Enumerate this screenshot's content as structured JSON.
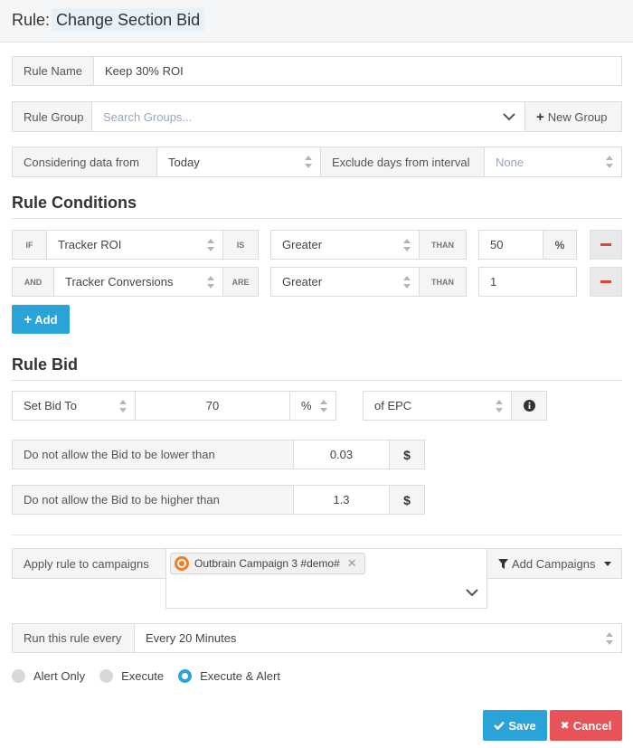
{
  "header": {
    "label": "Rule:",
    "title": "Change Section Bid"
  },
  "rule_name": {
    "label": "Rule Name",
    "value": "Keep 30% ROI"
  },
  "rule_group": {
    "label": "Rule Group",
    "placeholder": "Search Groups...",
    "new_group_label": "New Group"
  },
  "interval": {
    "label": "Considering data from",
    "value": "Today",
    "exclude_label": "Exclude days from interval",
    "exclude_value": "None"
  },
  "conditions": {
    "title": "Rule Conditions",
    "rows": [
      {
        "connector": "IF",
        "metric": "Tracker ROI",
        "verb": "IS",
        "operator": "Greater",
        "than": "THAN",
        "value": "50",
        "unit": "%"
      },
      {
        "connector": "AND",
        "metric": "Tracker Conversions",
        "verb": "ARE",
        "operator": "Greater",
        "than": "THAN",
        "value": "1",
        "unit": ""
      }
    ],
    "add_label": "Add"
  },
  "bid": {
    "title": "Rule Bid",
    "action": "Set Bid To",
    "amount": "70",
    "unit": "%",
    "reference": "of EPC",
    "min_label": "Do not allow the Bid to be lower than",
    "min_value": "0.03",
    "min_unit": "$",
    "max_label": "Do not allow the Bid to be higher than",
    "max_value": "1.3",
    "max_unit": "$"
  },
  "campaigns": {
    "label": "Apply rule to campaigns",
    "selected": [
      "Outbrain Campaign 3 #demo#"
    ],
    "add_label": "Add Campaigns"
  },
  "schedule": {
    "label": "Run this rule every",
    "value": "Every 20 Minutes"
  },
  "mode": {
    "options": [
      "Alert Only",
      "Execute",
      "Execute & Alert"
    ],
    "selected": "Execute & Alert"
  },
  "footer": {
    "save_label": "Save",
    "cancel_label": "Cancel"
  },
  "colors": {
    "accent": "#2aa3d8",
    "danger": "#e85357",
    "remove": "#e0433b"
  }
}
